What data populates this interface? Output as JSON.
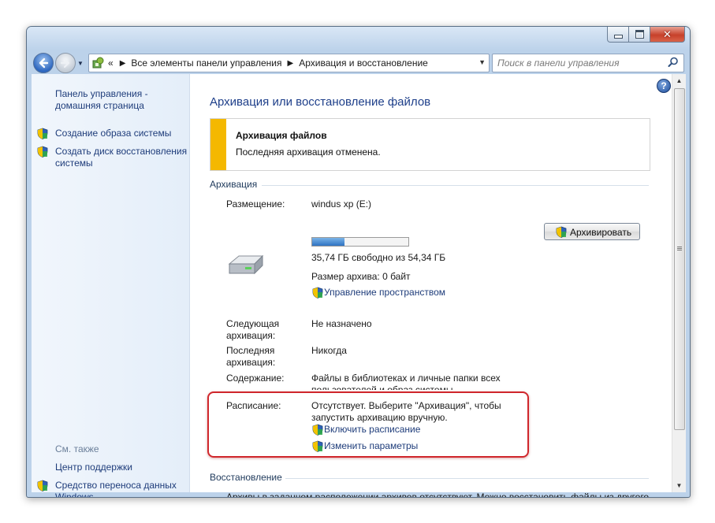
{
  "window": {
    "buttons": {
      "minimize": "minimize",
      "maximize": "maximize",
      "close": "close"
    }
  },
  "nav": {
    "crumbs": [
      "Все элементы панели управления",
      "Архивация и восстановление"
    ],
    "search_placeholder": "Поиск в панели управления"
  },
  "left_pane": {
    "home_link": "Панель управления - домашняя страница",
    "tasks": [
      "Создание образа системы",
      "Создать диск восстановления системы"
    ],
    "see_also_title": "См. также",
    "see_also": [
      "Центр поддержки",
      "Средство переноса данных Windows"
    ]
  },
  "main": {
    "title": "Архивация или восстановление файлов",
    "notice": {
      "title": "Архивация файлов",
      "text": "Последняя архивация отменена.",
      "color": "#f4b800"
    },
    "backup_section": "Архивация",
    "location_label": "Размещение:",
    "drive_name": "windus xp (E:)",
    "drive_used_fraction": 0.34,
    "free_space": "35,74 ГБ свободно из 54,34 ГБ",
    "archive_size": "Размер архива: 0 байт",
    "manage_space_link": "Управление пространством",
    "backup_button": "Архивировать",
    "next_backup_label": "Следующая архивация:",
    "next_backup_value": "Не назначено",
    "last_backup_label": "Последняя архивация:",
    "last_backup_value": "Никогда",
    "contents_label": "Содержание:",
    "contents_value": "Файлы в библиотеках и личные папки всех пользователей и образ системы",
    "schedule_label": "Расписание:",
    "schedule_value": "Отсутствует. Выберите \"Архивация\", чтобы запустить архивацию вручную.",
    "enable_schedule_link": "Включить расписание",
    "change_settings_link": "Изменить параметры",
    "highlight_color": "#d0272c",
    "restore_section": "Восстановление",
    "restore_text": "Архивы в заданном расположении архивов отсутствуют. Можно восстановить файлы из другого расположения."
  }
}
